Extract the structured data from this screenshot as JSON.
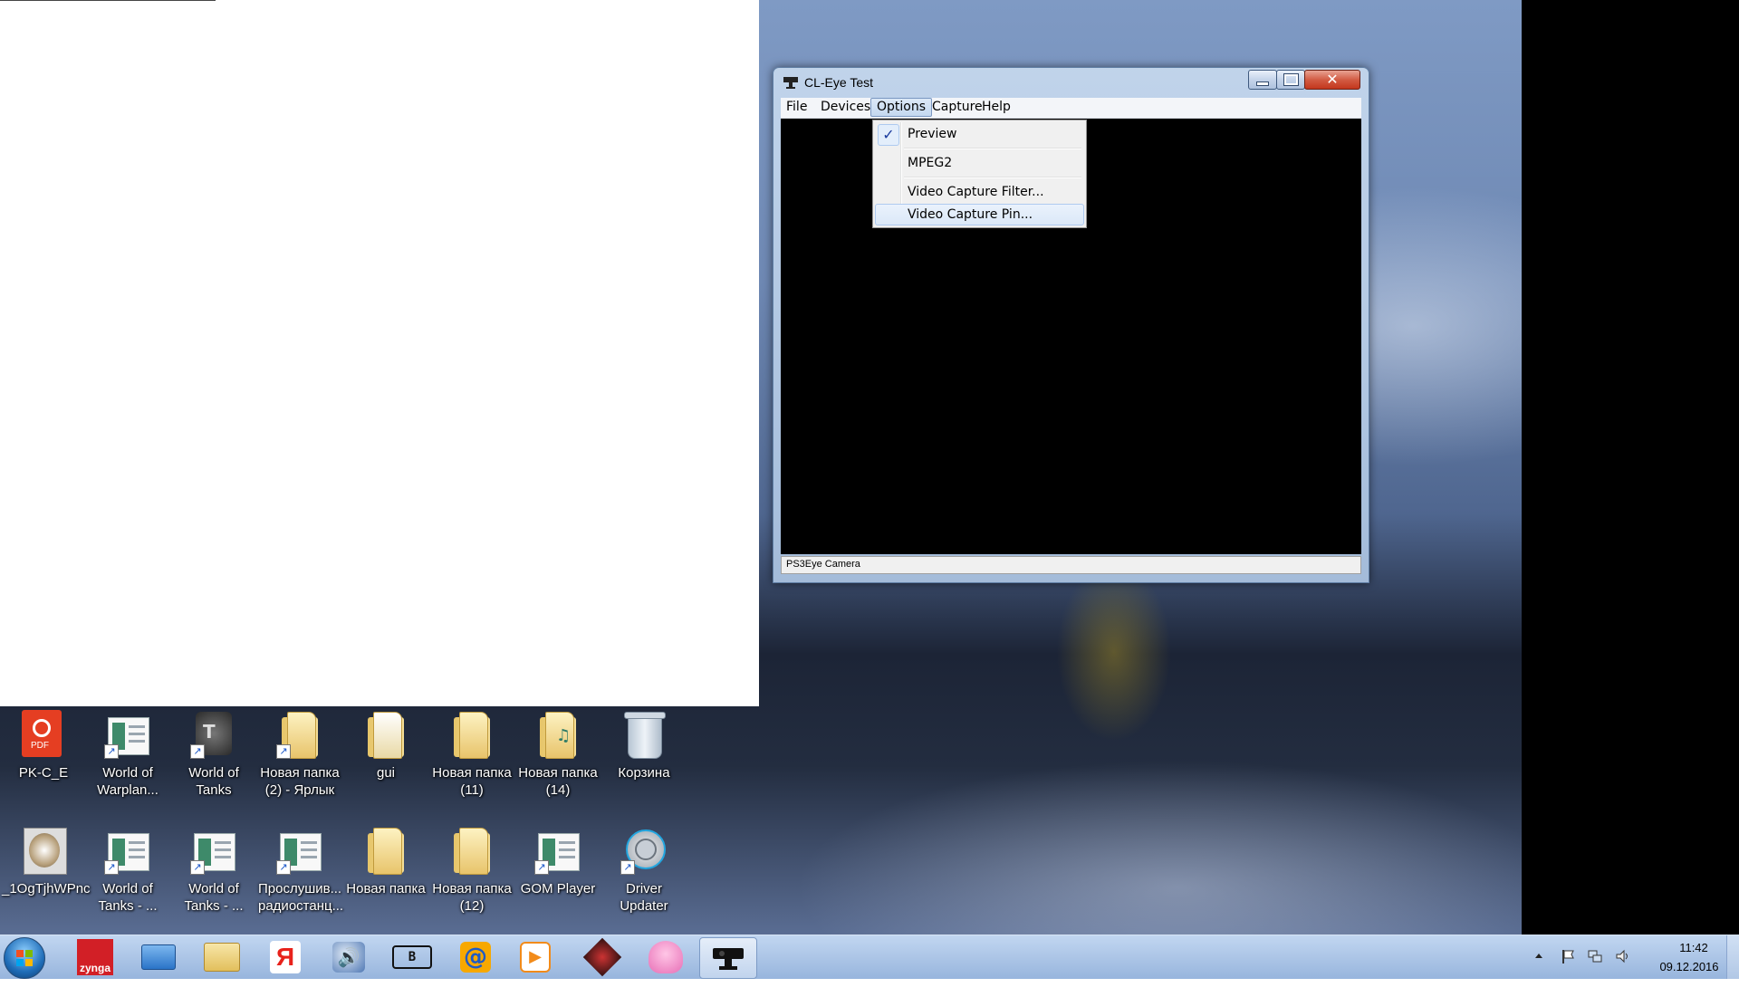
{
  "window": {
    "title": "CL-Eye Test",
    "menu": [
      "File",
      "Devices",
      "Options",
      "Capture",
      "Help"
    ],
    "status": "PS3Eye Camera"
  },
  "options_menu": {
    "items": [
      {
        "label": "Preview",
        "checked": true
      },
      {
        "label": "MPEG2",
        "checked": false
      },
      {
        "label": "Video Capture Filter...",
        "checked": false
      },
      {
        "label": "Video Capture Pin...",
        "checked": false,
        "highlighted": true
      }
    ]
  },
  "desktop_icons": [
    {
      "label": "PK-C_E",
      "icon": "pdf-icon"
    },
    {
      "label": "World of Warplan...",
      "icon": "shortcut-app-icon"
    },
    {
      "label": "World of Tanks",
      "icon": "world-of-tanks-icon"
    },
    {
      "label": "Новая папка (2) - Ярлык",
      "icon": "folder-shortcut-icon"
    },
    {
      "label": "gui",
      "icon": "folder-icon"
    },
    {
      "label": "Новая папка (11)",
      "icon": "folder-icon"
    },
    {
      "label": "Новая папка (14)",
      "icon": "music-folder-icon"
    },
    {
      "label": "Корзина",
      "icon": "recycle-bin-icon"
    },
    {
      "label": "_1OgTjhWPnc",
      "icon": "image-file-icon"
    },
    {
      "label": "World of Tanks - ...",
      "icon": "shortcut-app-icon"
    },
    {
      "label": "World of Tanks - ...",
      "icon": "shortcut-app-icon"
    },
    {
      "label": "Прослушив... радиостанц...",
      "icon": "shortcut-app-icon"
    },
    {
      "label": "Новая папка",
      "icon": "folder-icon"
    },
    {
      "label": "Новая папка (12)",
      "icon": "folder-icon"
    },
    {
      "label": "GOM Player",
      "icon": "shortcut-app-icon"
    },
    {
      "label": "Driver Updater",
      "icon": "driver-updater-icon"
    }
  ],
  "taskbar": {
    "pinned": [
      "start-orb",
      "zynga-icon",
      "mail-icon",
      "explorer-icon",
      "yandex-icon",
      "volume-app-icon",
      "bird-icon",
      "mail-ru-icon",
      "media-player-icon",
      "game-icon",
      "octopus-icon",
      "camera-icon"
    ],
    "zynga_label": "zynga",
    "yandex_label": "Я",
    "clock_time": "11:42",
    "clock_date": "09.12.2016"
  }
}
